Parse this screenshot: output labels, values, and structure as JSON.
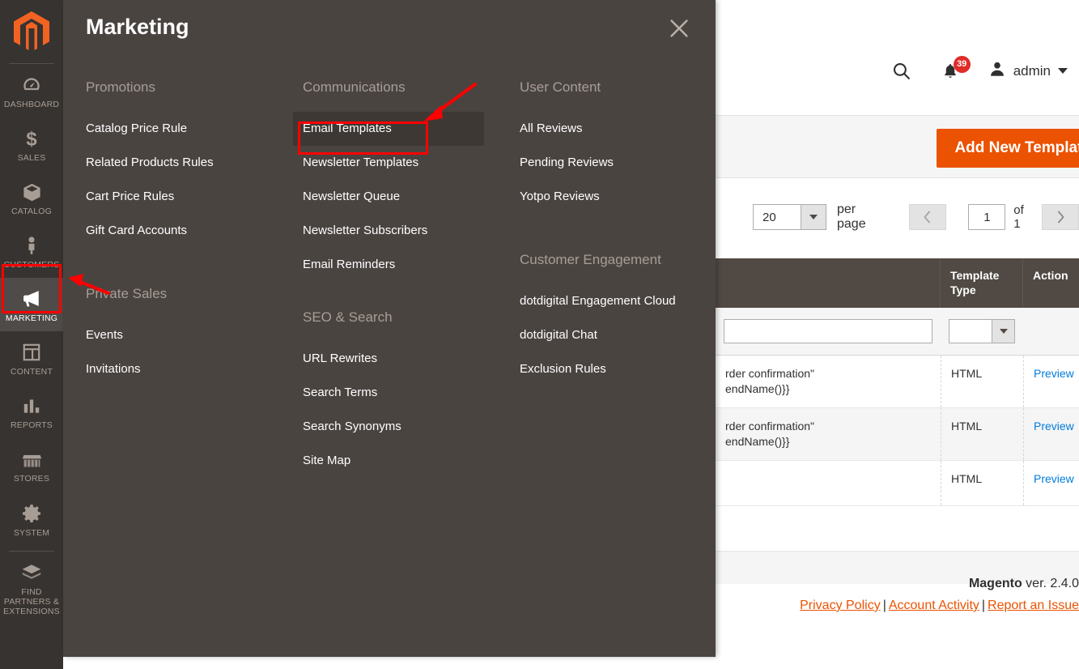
{
  "sidebar": {
    "logo_name": "magento-logo",
    "items": [
      {
        "label": "DASHBOARD",
        "icon": "dashboard-icon",
        "active": false
      },
      {
        "label": "SALES",
        "icon": "dollar-icon",
        "active": false
      },
      {
        "label": "CATALOG",
        "icon": "box-icon",
        "active": false
      },
      {
        "label": "CUSTOMERS",
        "icon": "person-icon",
        "active": false
      },
      {
        "label": "MARKETING",
        "icon": "megaphone-icon",
        "active": true
      },
      {
        "label": "CONTENT",
        "icon": "layout-icon",
        "active": false
      },
      {
        "label": "REPORTS",
        "icon": "bar-chart-icon",
        "active": false
      },
      {
        "label": "STORES",
        "icon": "store-icon",
        "active": false
      },
      {
        "label": "SYSTEM",
        "icon": "gear-icon",
        "active": false
      },
      {
        "label": "FIND PARTNERS & EXTENSIONS",
        "icon": "extensions-icon",
        "active": false
      }
    ]
  },
  "header": {
    "search_icon": "search-icon",
    "notifications_icon": "bell-icon",
    "notifications_count": "39",
    "avatar_icon": "user-avatar-icon",
    "admin_name": "admin",
    "caret_icon": "chevron-down-icon"
  },
  "content_actions": {
    "add_new_template_label": "Add New Template"
  },
  "pager": {
    "per_page_value": "20",
    "per_page_label": "per page",
    "prev_icon": "chevron-left-icon",
    "next_icon": "chevron-right-icon",
    "current_page": "1",
    "of_label": "of 1"
  },
  "grid": {
    "columns": [
      "",
      "Template Type",
      "Action"
    ],
    "filters": {
      "subject_value": "",
      "template_type_value": ""
    },
    "rows": [
      {
        "subject": "rder confirmation\"\nendName()}}",
        "template_type": "HTML",
        "action": "Preview"
      },
      {
        "subject": "rder confirmation\"\nendName()}}",
        "template_type": "HTML",
        "action": "Preview"
      },
      {
        "subject": "",
        "template_type": "HTML",
        "action": "Preview"
      }
    ]
  },
  "footer": {
    "brand": "Magento",
    "version": " ver. 2.4.0",
    "links": [
      "Privacy Policy",
      "Account Activity",
      "Report an Issue"
    ],
    "separator": "|"
  },
  "menu_panel": {
    "title": "Marketing",
    "close_icon": "close-icon",
    "columns": [
      {
        "groups": [
          {
            "title": "Promotions",
            "items": [
              {
                "label": "Catalog Price Rule",
                "hovered": false
              },
              {
                "label": "Related Products Rules",
                "hovered": false
              },
              {
                "label": "Cart Price Rules",
                "hovered": false
              },
              {
                "label": "Gift Card Accounts",
                "hovered": false
              }
            ]
          },
          {
            "title": "Private Sales",
            "items": [
              {
                "label": "Events",
                "hovered": false
              },
              {
                "label": "Invitations",
                "hovered": false
              }
            ]
          }
        ]
      },
      {
        "groups": [
          {
            "title": "Communications",
            "items": [
              {
                "label": "Email Templates",
                "hovered": true
              },
              {
                "label": "Newsletter Templates",
                "hovered": false
              },
              {
                "label": "Newsletter Queue",
                "hovered": false
              },
              {
                "label": "Newsletter Subscribers",
                "hovered": false
              },
              {
                "label": "Email Reminders",
                "hovered": false
              }
            ]
          },
          {
            "title": "SEO & Search",
            "items": [
              {
                "label": "URL Rewrites",
                "hovered": false
              },
              {
                "label": "Search Terms",
                "hovered": false
              },
              {
                "label": "Search Synonyms",
                "hovered": false
              },
              {
                "label": "Site Map",
                "hovered": false
              }
            ]
          }
        ]
      },
      {
        "groups": [
          {
            "title": "User Content",
            "items": [
              {
                "label": "All Reviews",
                "hovered": false
              },
              {
                "label": "Pending Reviews",
                "hovered": false
              },
              {
                "label": "Yotpo Reviews",
                "hovered": false
              }
            ]
          },
          {
            "title": "Customer Engagement",
            "items": [
              {
                "label": "dotdigital Engagement Cloud",
                "hovered": false
              },
              {
                "label": "dotdigital Chat",
                "hovered": false
              },
              {
                "label": "Exclusion Rules",
                "hovered": false
              }
            ]
          }
        ]
      }
    ]
  },
  "annotations": {
    "highlight_color": "#ff0000",
    "boxes": [
      {
        "name": "marketing-sidebar-highlight"
      },
      {
        "name": "email-templates-highlight"
      }
    ],
    "arrows": [
      {
        "name": "arrow-to-marketing"
      },
      {
        "name": "arrow-to-email-templates"
      }
    ]
  },
  "colors": {
    "accent": "#eb5202",
    "panel_bg": "#4a4441",
    "sidebar_bg": "#373330",
    "badge": "#e02b27",
    "link": "#007bdb"
  }
}
